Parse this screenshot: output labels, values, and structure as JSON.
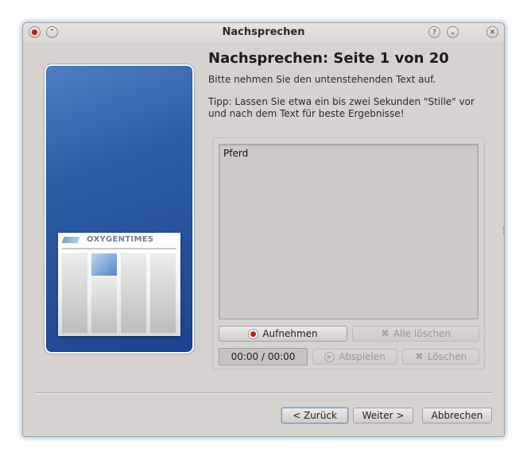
{
  "window": {
    "title": "Nachsprechen"
  },
  "titlebar": {
    "help_glyph": "?",
    "minimize_glyph": "⌄",
    "close_glyph": "✕",
    "keep_above_glyph": "⌃"
  },
  "side_image": {
    "newspaper_title": "OXYGENTIMES"
  },
  "page": {
    "heading": "Nachsprechen: Seite 1 von 20",
    "instruction": "Bitte nehmen Sie den untenstehenden Text auf.",
    "tip": "Tipp: Lassen Sie etwa ein bis zwei Sekunden \"Stille\" vor und nach dem Text für beste Ergebnisse!",
    "prompt_text": "Pferd"
  },
  "recorder": {
    "record_label": "Aufnehmen",
    "clear_all_label": "Alle löschen",
    "time": "00:00 / 00:00",
    "play_label": "Abspielen",
    "delete_label": "Löschen"
  },
  "wizard": {
    "back_label": "< Zurück",
    "next_label": "Weiter >",
    "cancel_label": "Abbrechen"
  },
  "colors": {
    "record_red": "#d0161b",
    "image_blue": "#2d5da6",
    "window_bg": "#d6d2ce"
  }
}
